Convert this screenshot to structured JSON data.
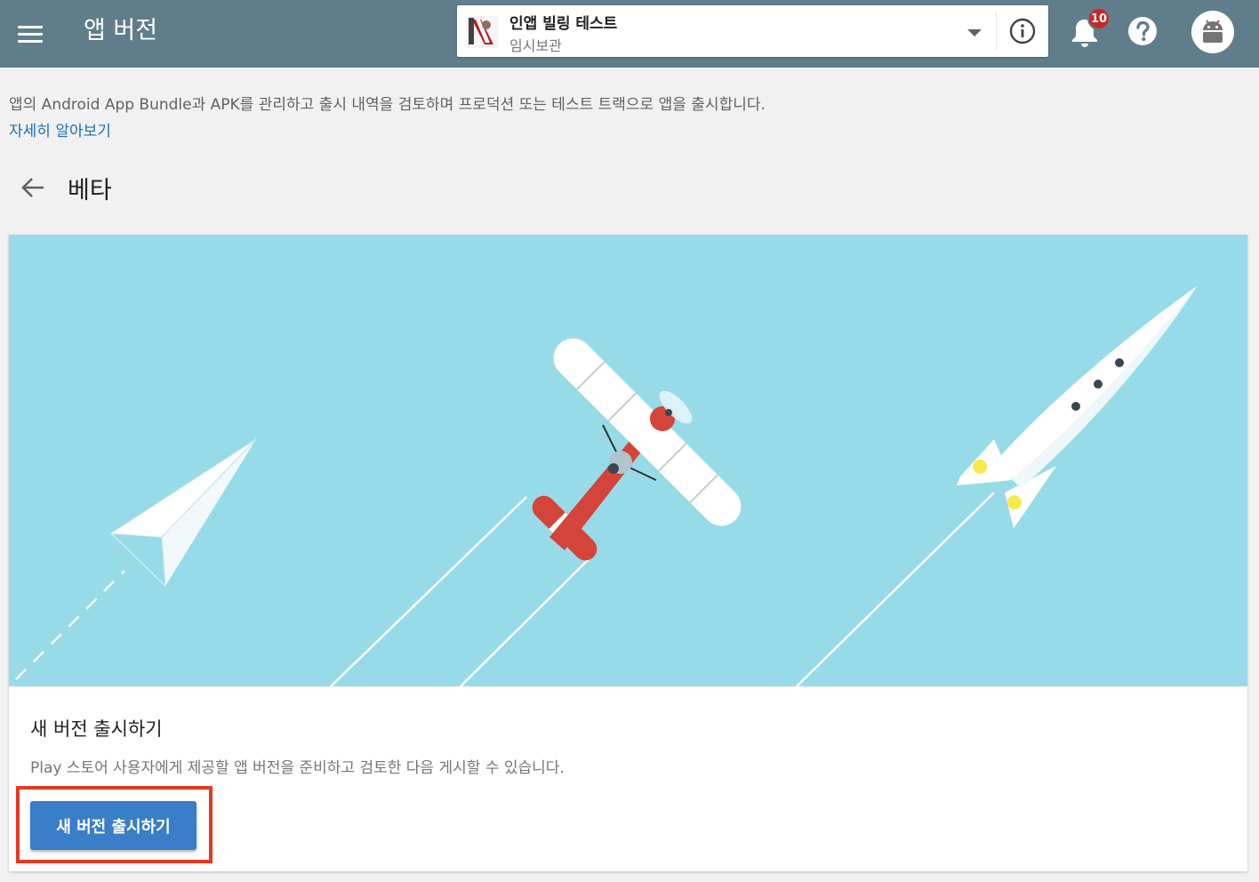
{
  "header": {
    "page_title": "앱 버전",
    "app_name": "인앱 빌링 테스트",
    "app_status": "임시보관",
    "notification_count": "10",
    "bg_color": "#607d8b"
  },
  "icons": {
    "menu": "hamburger-menu-icon",
    "dropdown": "caret-down-icon",
    "info": "info-icon",
    "notifications": "bell-icon",
    "help": "help-icon",
    "account": "android-avatar-icon",
    "back": "arrow-back-icon"
  },
  "intro": {
    "description": "앱의 Android App Bundle과 APK를 관리하고 출시 내역을 검토하며 프로덕션 또는 테스트 트랙으로 앱을 출시합니다.",
    "learn_more": "자세히 알아보기"
  },
  "track": {
    "title": "베타"
  },
  "card": {
    "title": "새 버전 출시하기",
    "description": "Play 스토어 사용자에게 제공할 앱 버전을 준비하고 검토한 다음 게시할 수 있습니다.",
    "button_label": "새 버전 출시하기",
    "button_color": "#3a7dc8",
    "highlight_color": "#e53922",
    "hero_bg": "#97dbe8"
  }
}
